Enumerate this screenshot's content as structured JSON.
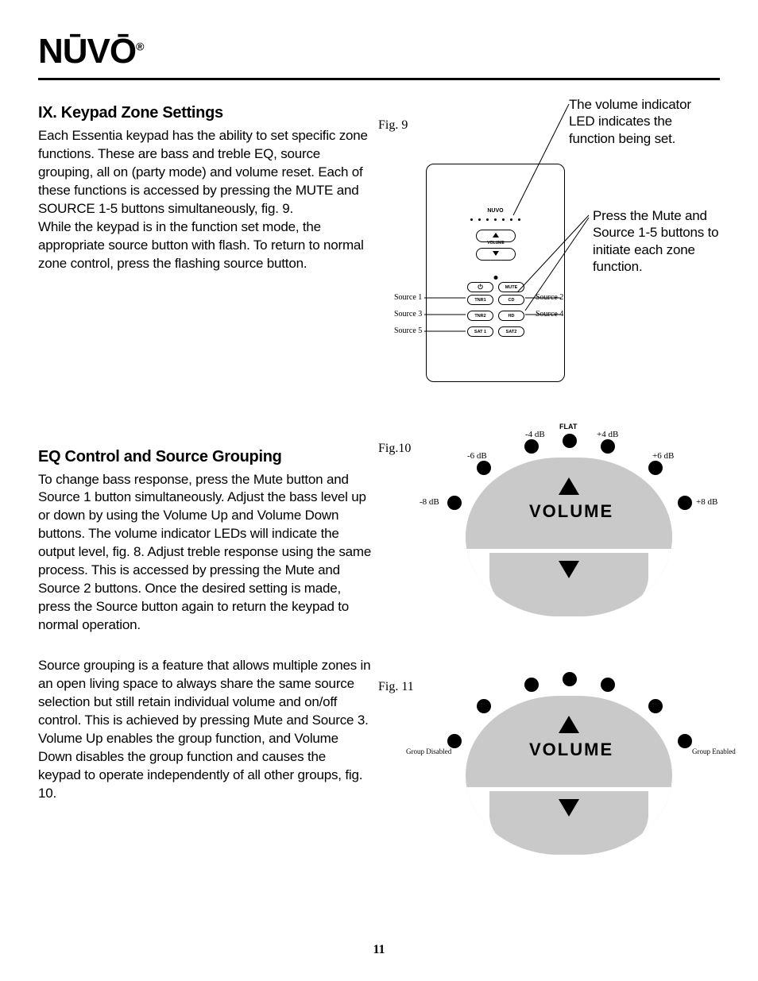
{
  "brand": {
    "name": "NŪVŌ",
    "registered": "®"
  },
  "page_number": "11",
  "section1": {
    "heading": "IX. Keypad Zone Settings",
    "p1": "Each Essentia keypad has the ability to set specific zone functions. These are bass and treble EQ, source grouping, all on (party mode) and volume reset. Each of these functions is accessed by pressing the MUTE and SOURCE 1-5 buttons simultaneously, fig. 9.",
    "p2": "While the keypad is in the function set mode, the appropriate source button with flash. To return to normal zone control, press the flashing source button."
  },
  "section2": {
    "heading": "EQ Control and Source Grouping",
    "p1": "To change bass response, press the Mute button and Source 1 button simultaneously. Adjust the bass level up or down by using the Volume Up and Volume Down buttons. The volume indicator LEDs will indicate the output level, fig. 8. Adjust treble response using the same process. This is accessed by pressing the Mute and Source 2 buttons. Once the desired setting is made, press the Source button again to return the keypad to normal operation.",
    "p2": "Source grouping is a feature that allows multiple zones in an open living space to always share the same source selection but still retain individual volume and on/off control. This is achieved by pressing Mute and Source 3. Volume Up enables the group function, and Volume Down disables the group function and causes the keypad to operate independently of all other groups, fig. 10."
  },
  "fig9": {
    "label": "Fig. 9",
    "callout1": "The volume indicator LED indicates the function being set.",
    "callout2": "Press the Mute and Source 1-5 buttons to initiate each zone function.",
    "keypad": {
      "brand": "NUVO",
      "volume_up": "▲",
      "volume_label": "VOLUME",
      "volume_down": "▼",
      "power": "⏻",
      "mute": "MUTE",
      "buttons": [
        "TNR1",
        "CD",
        "TNR2",
        "HD",
        "SAT 1",
        "SAT2"
      ],
      "src_labels": [
        "Source 1",
        "Source 2",
        "Source 3",
        "Source 4",
        "Source 5"
      ]
    }
  },
  "fig10": {
    "label": "Fig.10",
    "volume_label": "VOLUME",
    "db_labels": {
      "n8": "-8 dB",
      "n6": "-6 dB",
      "n4": "-4 dB",
      "flat": "FLAT",
      "p4": "+4 dB",
      "p6": "+6 dB",
      "p8": "+8 dB"
    }
  },
  "fig11": {
    "label": "Fig. 11",
    "volume_label": "VOLUME",
    "left_label": "Group Disabled",
    "right_label": "Group Enabled"
  }
}
